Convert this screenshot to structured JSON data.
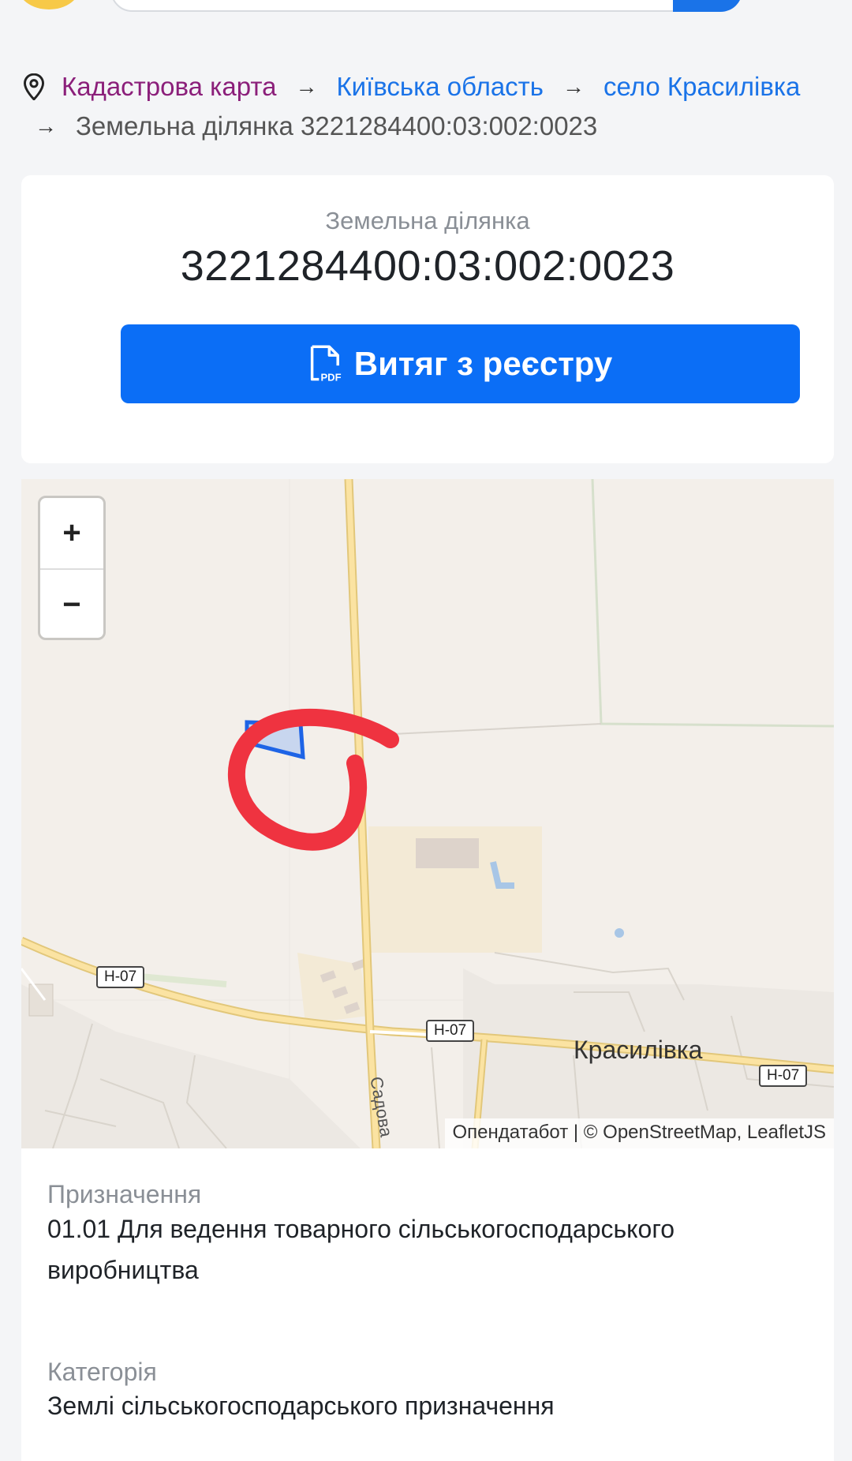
{
  "breadcrumb": {
    "items": [
      "Кадастрова карта",
      "Київська область",
      "село Красилівка"
    ],
    "separator": "→",
    "current": "Земельна ділянка 3221284400:03:002:0023"
  },
  "card": {
    "subtitle": "Земельна ділянка",
    "title": "3221284400:03:002:0023",
    "button_label": "Витяг з реєстру",
    "button_icon": "pdf-icon",
    "button_icon_text": "PDF"
  },
  "map": {
    "zoom_in": "+",
    "zoom_out": "−",
    "place_name": "Красилівка",
    "road_labels": [
      "Н-07",
      "Н-07",
      "Н-07"
    ],
    "street_label": "Садова",
    "attribution": "Опендатабот | © OpenStreetMap, LeafletJS"
  },
  "details": {
    "purpose_label": "Призначення",
    "purpose_value": "01.01 Для ведення товарного сільськогосподарського виробництва",
    "category_label": "Категорія",
    "category_value": "Землі сільськогосподарського призначення"
  },
  "colors": {
    "accent": "#0b6ef6",
    "link_visited": "#8b1f7a",
    "link": "#1a73e8",
    "annotation": "#ef3340"
  }
}
